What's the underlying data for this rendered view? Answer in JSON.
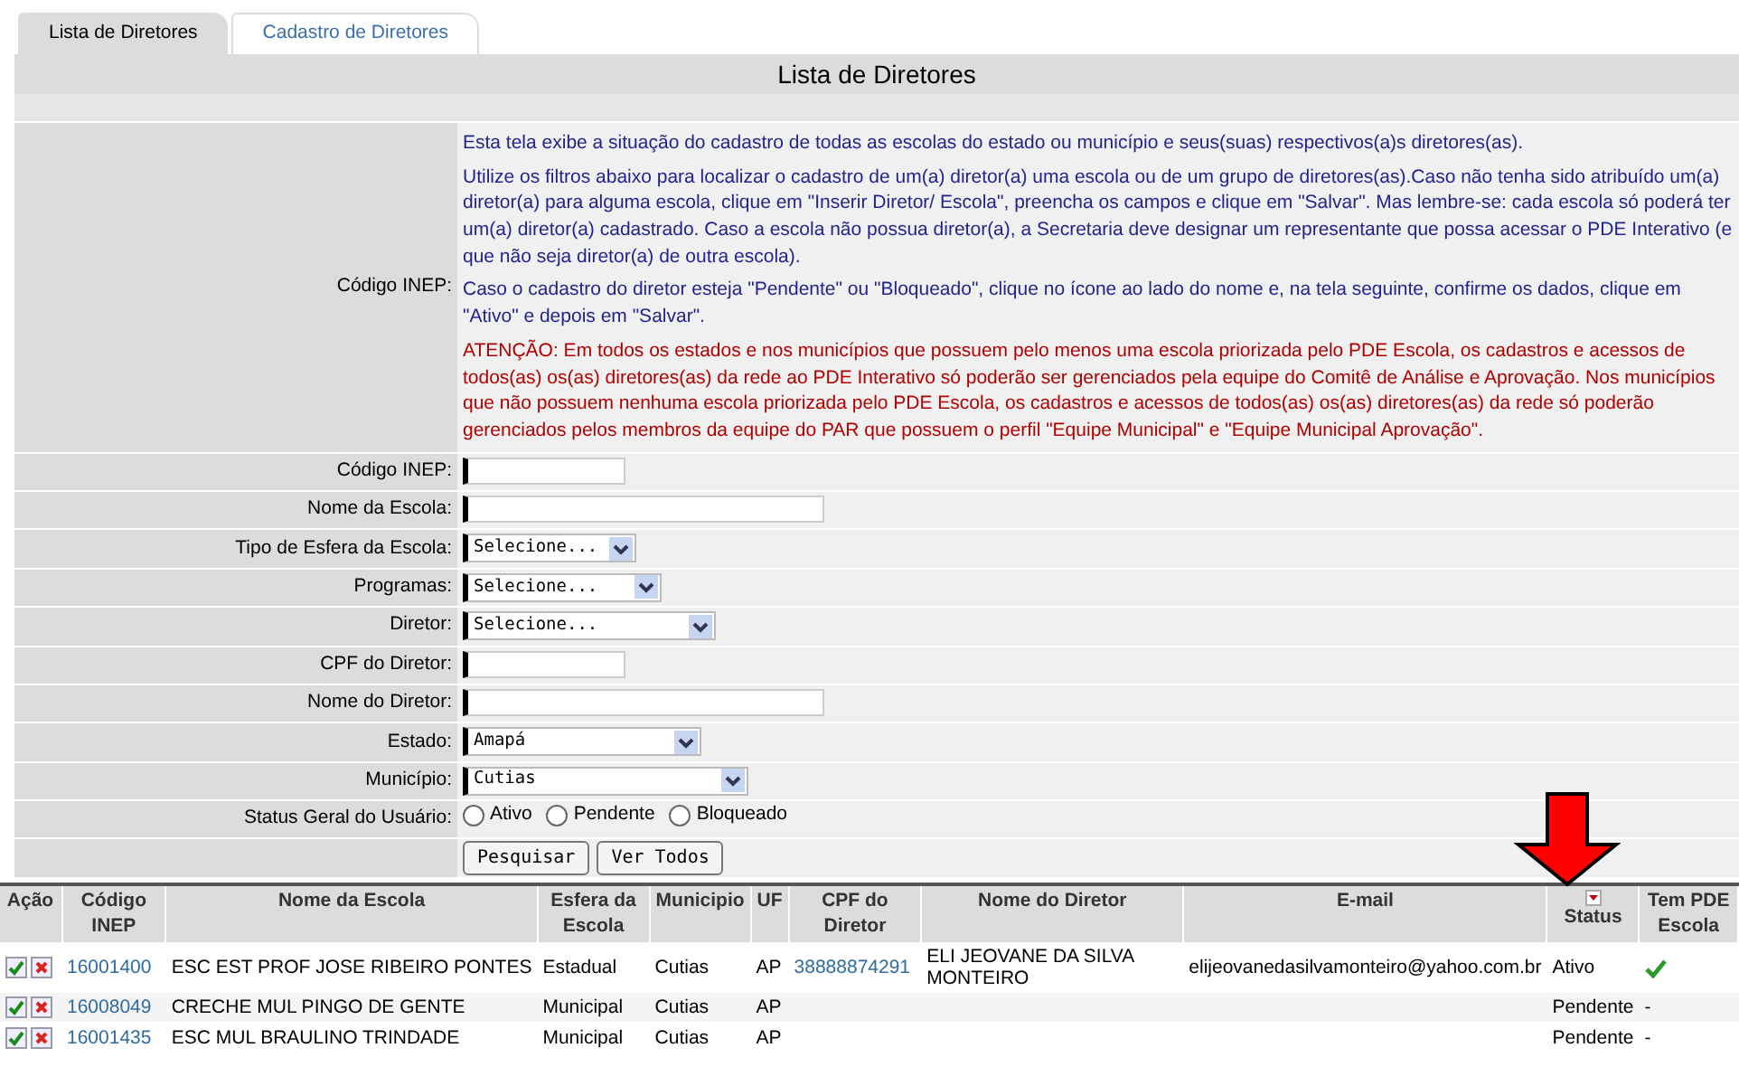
{
  "tabs": [
    {
      "label": "Lista de Diretores",
      "selected": true
    },
    {
      "label": "Cadastro de Diretores",
      "selected": false
    }
  ],
  "title": "Lista de Diretores",
  "info": {
    "label": "Código INEP:",
    "paragraphs": [
      {
        "kind": "normal",
        "text": "Esta tela exibe a situação do cadastro de todas as escolas do estado ou município e seus(suas) respectivos(a)s diretores(as)."
      },
      {
        "kind": "normal",
        "text": "Utilize os filtros abaixo para localizar o cadastro de um(a) diretor(a) uma escola ou de um grupo de diretores(as).Caso não tenha sido atribuído um(a) diretor(a) para alguma escola, clique em \"Inserir Diretor/ Escola\", preencha os campos e clique em \"Salvar\". Mas lembre-se: cada escola só poderá ter um(a) diretor(a) cadastrado. Caso a escola não possua diretor(a), a Secretaria deve designar um representante que possa acessar o PDE Interativo (e que não seja diretor(a) de outra escola)."
      },
      {
        "kind": "normal",
        "text": "Caso o cadastro do diretor esteja \"Pendente\" ou \"Bloqueado\", clique no ícone ao lado do nome e, na tela seguinte, confirme os dados, clique em \"Ativo\" e depois em \"Salvar\"."
      },
      {
        "kind": "warning",
        "text": "ATENÇÃO: Em todos os estados e nos municípios que possuem pelo menos uma escola priorizada pelo PDE Escola, os cadastros e acessos de todos(as) os(as) diretores(as) da rede ao PDE Interativo só poderão ser gerenciados pela equipe do Comitê de Análise e Aprovação. Nos municípios que não possuem nenhuma escola priorizada pelo PDE Escola, os cadastros e acessos de todos(as) os(as) diretores(as) da rede só poderão gerenciados pelos membros da equipe do PAR que possuem o perfil \"Equipe Municipal\" e \"Equipe Municipal Aprovação\"."
      }
    ]
  },
  "filters": [
    {
      "kind": "text",
      "label": "Código INEP:"
    },
    {
      "kind": "text",
      "label": "Nome da Escola:"
    },
    {
      "kind": "select",
      "label": "Tipo de Esfera da Escola:",
      "value": "Selecione..."
    },
    {
      "kind": "select",
      "label": "Programas:",
      "value": "Selecione..."
    },
    {
      "kind": "select",
      "label": "Diretor:",
      "value": "Selecione..."
    },
    {
      "kind": "text",
      "label": "CPF do Diretor:"
    },
    {
      "kind": "text",
      "label": "Nome do Diretor:"
    },
    {
      "kind": "select",
      "label": "Estado:",
      "value": "Amapá"
    },
    {
      "kind": "select",
      "label": "Município:",
      "value": "Cutias"
    },
    {
      "kind": "radio",
      "label": "Status Geral do Usuário:",
      "options": [
        {
          "label": "Ativo",
          "selected": false
        },
        {
          "label": "Pendente",
          "selected": false
        },
        {
          "label": "Bloqueado",
          "selected": false
        }
      ]
    }
  ],
  "buttons": [
    "Pesquisar",
    "Ver Todos"
  ],
  "table": {
    "columns": [
      {
        "label": "Ação",
        "sorted": false
      },
      {
        "label": "Código INEP",
        "sorted": false
      },
      {
        "label": "Nome da Escola",
        "sorted": false
      },
      {
        "label": "Esfera da Escola",
        "sorted": false
      },
      {
        "label": "Municipio",
        "sorted": false
      },
      {
        "label": "UF",
        "sorted": false
      },
      {
        "label": "CPF do Diretor",
        "sorted": false
      },
      {
        "label": "Nome do Diretor",
        "sorted": false
      },
      {
        "label": "E-mail",
        "sorted": false
      },
      {
        "label": "Status",
        "sorted": true
      },
      {
        "label": "Tem PDE Escola",
        "sorted": false
      }
    ],
    "rows": [
      {
        "codigo": "16001400",
        "escola": "ESC EST PROF JOSE RIBEIRO PONTES",
        "esfera": "Estadual",
        "municipio": "Cutias",
        "uf": "AP",
        "cpf": "38888874291",
        "diretor": "ELI JEOVANE DA SILVA MONTEIRO",
        "email": "elijeovanedasilvamonteiro@yahoo.com.br",
        "status": "Ativo",
        "tem_pde": {
          "kind": "check"
        }
      },
      {
        "codigo": "16008049",
        "escola": "CRECHE MUL PINGO DE GENTE",
        "esfera": "Municipal",
        "municipio": "Cutias",
        "uf": "AP",
        "status": "Pendente",
        "tem_pde": {
          "kind": "text",
          "text": "-"
        }
      },
      {
        "codigo": "16001435",
        "escola": "ESC MUL BRAULINO TRINDADE",
        "esfera": "Municipal",
        "municipio": "Cutias",
        "uf": "AP",
        "status": "Pendente",
        "tem_pde": {
          "kind": "text",
          "text": "-"
        }
      }
    ]
  }
}
